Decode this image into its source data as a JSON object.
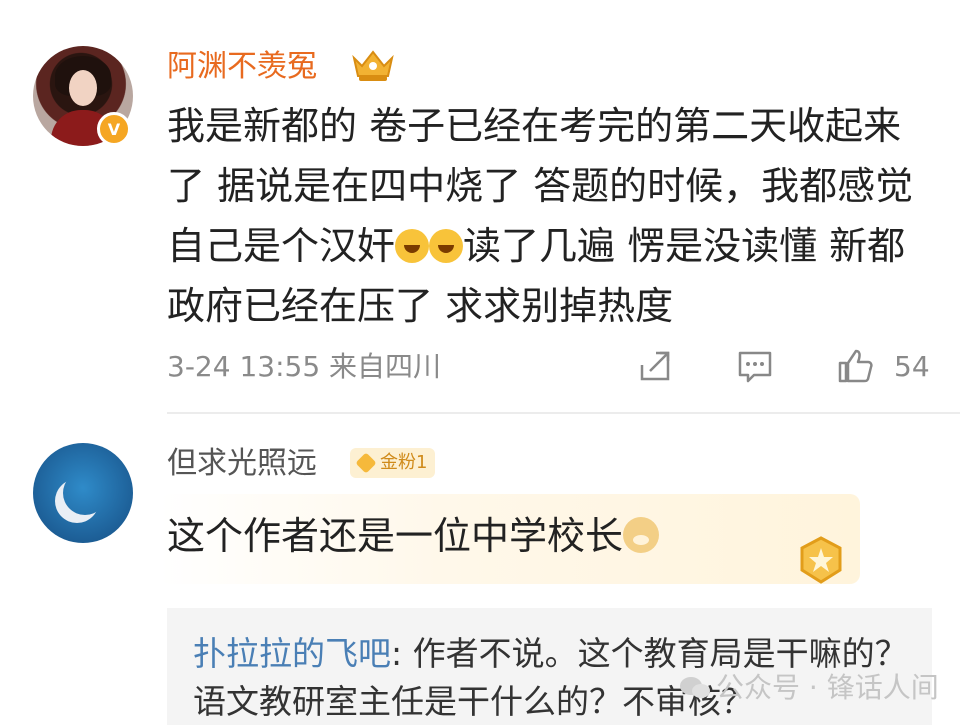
{
  "comment1": {
    "username": "阿渊不羡冤",
    "verified_badge": "V",
    "crown_icon": "crown-icon",
    "text_parts": [
      "我是新都的 卷子已经在考完的第二天收起来了 据说是在四中烧了 答题的时候，我都感觉自己是个汉奸",
      "读了几遍 愣是没读懂 新都政府已经在压了 求求别掉热度"
    ],
    "emoji": [
      "laugh-cry-emoji",
      "laugh-cry-emoji"
    ],
    "timestamp": "3-24 13:55",
    "location": "来自四川",
    "likes": "54"
  },
  "comment2": {
    "username": "但求光照远",
    "fan_badge": "金粉1",
    "text": "这个作者还是一位中学校长",
    "emoji": "doge-emoji"
  },
  "reply": {
    "name": "扑拉拉的飞吧",
    "text": ": 作者不说。这个教育局是干嘛的？语文教研室主任是干什么的？不审核？"
  },
  "watermark": {
    "text": "公众号 · 锋话人间"
  },
  "colors": {
    "username_orange": "#e86a1f",
    "reply_name_blue": "#4a7fb5",
    "meta_gray": "#8a8a8a"
  }
}
